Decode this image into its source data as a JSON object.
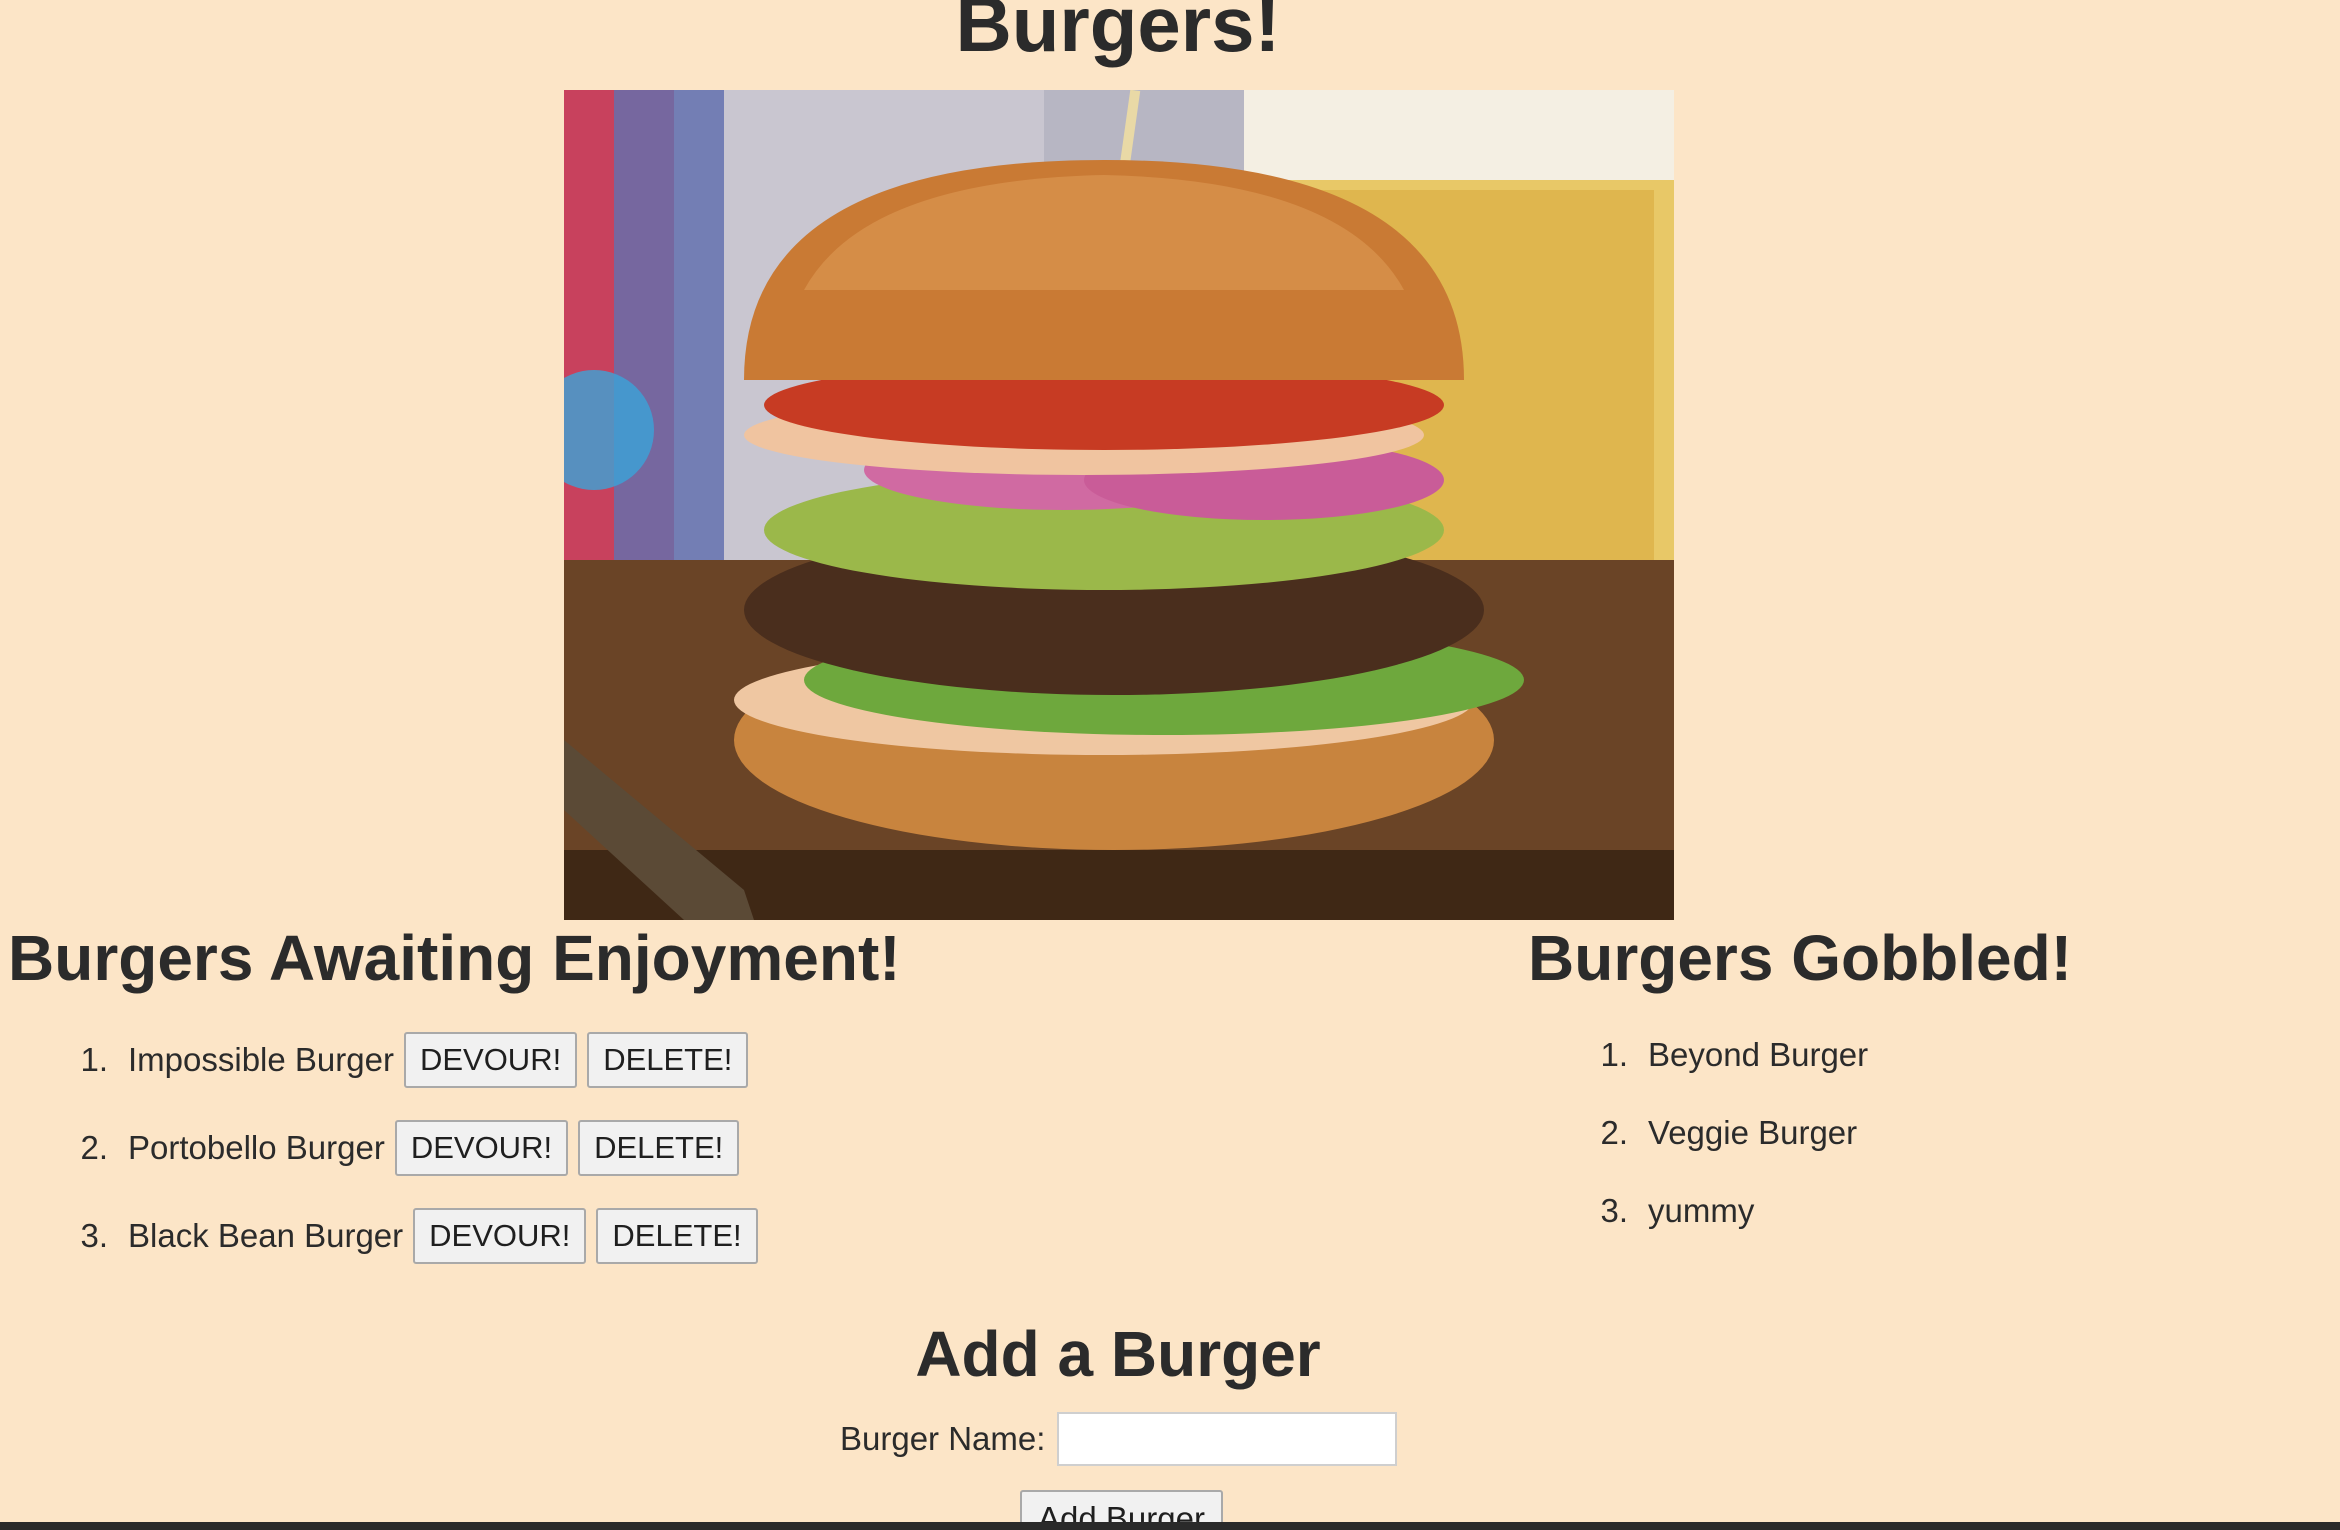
{
  "page": {
    "title": "Burgers!"
  },
  "awaiting": {
    "heading": "Burgers Awaiting Enjoyment!",
    "items": [
      {
        "num": "1.",
        "name": "Impossible Burger",
        "devour_label": "DEVOUR!",
        "delete_label": "DELETE!"
      },
      {
        "num": "2.",
        "name": "Portobello Burger",
        "devour_label": "DEVOUR!",
        "delete_label": "DELETE!"
      },
      {
        "num": "3.",
        "name": "Black Bean Burger",
        "devour_label": "DEVOUR!",
        "delete_label": "DELETE!"
      }
    ]
  },
  "gobbled": {
    "heading": "Burgers Gobbled!",
    "items": [
      {
        "num": "1.",
        "name": "Beyond Burger"
      },
      {
        "num": "2.",
        "name": "Veggie Burger"
      },
      {
        "num": "3.",
        "name": "yummy"
      }
    ]
  },
  "add_form": {
    "heading": "Add a Burger",
    "field_label": "Burger Name:",
    "field_value": "",
    "submit_label": "Add Burger"
  },
  "colors": {
    "background": "#fce5c7",
    "text": "#2b2b2b"
  }
}
